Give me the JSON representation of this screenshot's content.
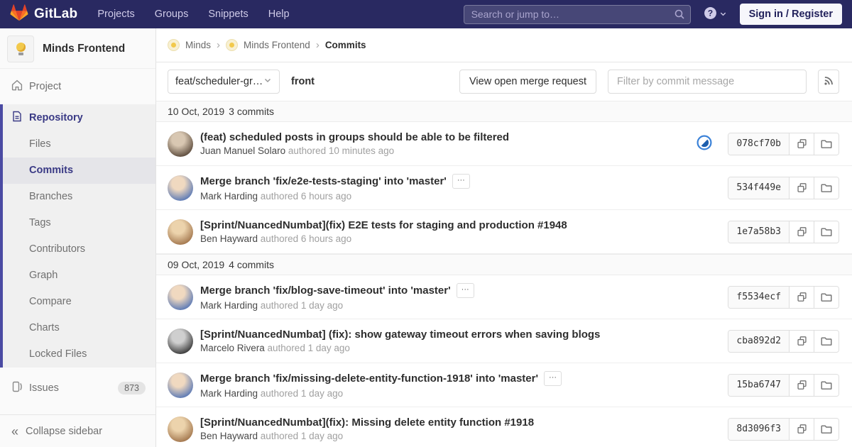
{
  "navbar": {
    "brand": "GitLab",
    "menu": [
      "Projects",
      "Groups",
      "Snippets",
      "Help"
    ],
    "search_placeholder": "Search or jump to…",
    "sign_in_label": "Sign in / Register"
  },
  "sidebar": {
    "project_name": "Minds Frontend",
    "project_item_label": "Project",
    "repository": {
      "label": "Repository",
      "subitems": [
        "Files",
        "Commits",
        "Branches",
        "Tags",
        "Contributors",
        "Graph",
        "Compare",
        "Charts",
        "Locked Files"
      ],
      "active": "Commits"
    },
    "issues": {
      "label": "Issues",
      "count": "873"
    },
    "collapse_label": "Collapse sidebar"
  },
  "breadcrumb": {
    "items": [
      {
        "label": "Minds",
        "avatar": true,
        "current": false
      },
      {
        "label": "Minds Frontend",
        "avatar": true,
        "current": false
      },
      {
        "label": "Commits",
        "avatar": false,
        "current": true
      }
    ]
  },
  "toolbar": {
    "branch_label": "feat/scheduler-gr…",
    "project_label": "front",
    "merge_request_label": "View open merge request",
    "filter_placeholder": "Filter by commit message"
  },
  "commits": {
    "expand_label": "···",
    "status_color": {
      "ring": "#3b82d8",
      "fill": "#1e5fae"
    },
    "groups": [
      {
        "date": "10 Oct, 2019",
        "count_label": "3 commits",
        "commits": [
          {
            "title": "(feat) scheduled posts in groups should be able to be filtered",
            "author": "Juan Manuel Solaro",
            "meta": "authored 10 minutes ago",
            "sha": "078cf70b",
            "pipeline": true,
            "ellipsis": false
          },
          {
            "title": "Merge branch 'fix/e2e-tests-staging' into 'master'",
            "author": "Mark Harding",
            "meta": "authored 6 hours ago",
            "sha": "534f449e",
            "pipeline": false,
            "ellipsis": true
          },
          {
            "title": "[Sprint/NuancedNumbat](fix) E2E tests for staging and production #1948",
            "author": "Ben Hayward",
            "meta": "authored 6 hours ago",
            "sha": "1e7a58b3",
            "pipeline": false,
            "ellipsis": false
          }
        ]
      },
      {
        "date": "09 Oct, 2019",
        "count_label": "4 commits",
        "commits": [
          {
            "title": "Merge branch 'fix/blog-save-timeout' into 'master'",
            "author": "Mark Harding",
            "meta": "authored 1 day ago",
            "sha": "f5534ecf",
            "pipeline": false,
            "ellipsis": true
          },
          {
            "title": "[Sprint/NuancedNumbat] (fix): show gateway timeout errors when saving blogs",
            "author": "Marcelo Rivera",
            "meta": "authored 1 day ago",
            "sha": "cba892d2",
            "pipeline": false,
            "ellipsis": false
          },
          {
            "title": "Merge branch 'fix/missing-delete-entity-function-1918' into 'master'",
            "author": "Mark Harding",
            "meta": "authored 1 day ago",
            "sha": "15ba6747",
            "pipeline": false,
            "ellipsis": true
          },
          {
            "title": "[Sprint/NuancedNumbat](fix): Missing delete entity function #1918",
            "author": "Ben Hayward",
            "meta": "authored 1 day ago",
            "sha": "8d3096f3",
            "pipeline": false,
            "ellipsis": false
          }
        ]
      }
    ]
  },
  "avatars": {
    "Juan Manuel Solaro": [
      "#d8c7b2",
      "#5d4c3d"
    ],
    "Mark Harding": [
      "#f0d9c0",
      "#5b79b5"
    ],
    "Ben Hayward": [
      "#ecd3ac",
      "#a3774e"
    ],
    "Marcelo Rivera": [
      "#cfcfcf",
      "#3a3a3a"
    ]
  },
  "colors": {
    "navbar_bg": "#292961",
    "sidebar_accent": "#4b4ba3",
    "active_text": "#3a3a85"
  }
}
